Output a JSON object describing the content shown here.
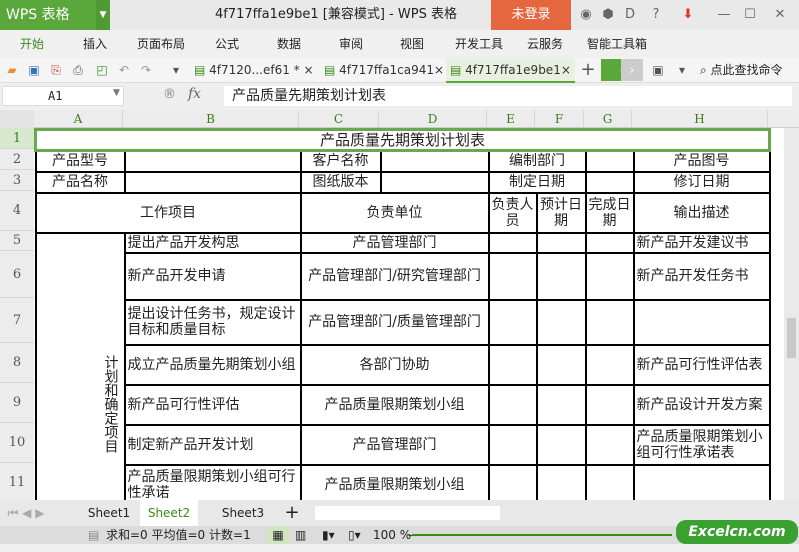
{
  "app": {
    "name": "WPS 表格",
    "doc_title": "4f717ffa1e9be1 [兼容模式] - WPS 表格",
    "login": "未登录"
  },
  "menu": [
    "开始",
    "插入",
    "页面布局",
    "公式",
    "数据",
    "审阅",
    "视图",
    "开发工具",
    "云服务",
    "智能工具箱"
  ],
  "doc_tabs": [
    {
      "label": "4f7120...ef61 *"
    },
    {
      "label": "4f717ffa1ca941"
    },
    {
      "label": "4f717ffa1e9be1"
    }
  ],
  "search_cmd": "点此查找命令",
  "formula_bar": {
    "cell": "A1",
    "fx": "fx",
    "value": "产品质量先期策划计划表"
  },
  "columns": [
    "A",
    "B",
    "C",
    "D",
    "E",
    "F",
    "G",
    "H"
  ],
  "rows": [
    "1",
    "2",
    "3",
    "4",
    "5",
    "6",
    "7",
    "8",
    "9",
    "10",
    "11"
  ],
  "sheet": {
    "title": "产品质量先期策划计划表",
    "r2": [
      "产品型号",
      "客户名称",
      "编制部门",
      "产品图号"
    ],
    "r3": [
      "产品名称",
      "图纸版本",
      "制定日期",
      "修订日期"
    ],
    "r4": [
      "工作项目",
      "负责单位",
      "负责人员",
      "预计日期",
      "完成日期",
      "输出描述"
    ],
    "group": "计划和确定项目",
    "items": [
      {
        "task": "提出产品开发构思",
        "unit": "产品管理部门",
        "output": "新产品开发建议书"
      },
      {
        "task": "新产品开发申请",
        "unit": "产品管理部门/研究管理部门",
        "output": "新产品开发任务书"
      },
      {
        "task": "提出设计任务书，规定设计目标和质量目标",
        "unit": "产品管理部门/质量管理部门",
        "output": ""
      },
      {
        "task": "成立产品质量先期策划小组",
        "unit": "各部门协助",
        "output": "新产品可行性评估表"
      },
      {
        "task": "新产品可行性评估",
        "unit": "产品质量限期策划小组",
        "output": "新产品设计开发方案"
      },
      {
        "task": "制定新产品开发计划",
        "unit": "产品管理部门",
        "output": "产品质量限期策划小组可行性承诺表"
      },
      {
        "task": "产品质量限期策划小组可行性承诺",
        "unit": "产品质量限期策划小组",
        "output": ""
      }
    ]
  },
  "sheets": [
    "Sheet1",
    "Sheet2",
    "Sheet3"
  ],
  "status": {
    "text": "求和=0  平均值=0  计数=1",
    "zoom": "100 %"
  },
  "watermark": "Excelcn.com",
  "colors": {
    "accent": "#5aa83c",
    "login": "#e5673f"
  }
}
